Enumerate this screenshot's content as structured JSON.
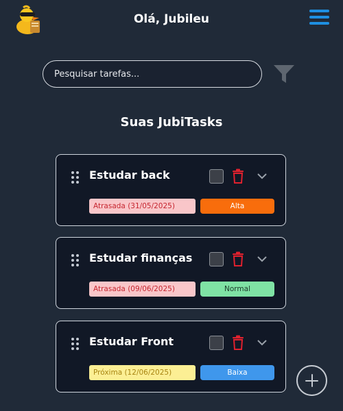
{
  "header": {
    "greeting": "Olá, Jubileu",
    "logo_icon": "duck-mascot-icon",
    "menu_icon": "hamburger-menu-icon"
  },
  "search": {
    "placeholder": "Pesquisar tarefas...",
    "value": "",
    "filter_icon": "filter-funnel-icon"
  },
  "section": {
    "title": "Suas JubiTasks"
  },
  "tasks": [
    {
      "title": "Estudar back",
      "due_label": "Atrasada (31/05/2025)",
      "due_status": "late",
      "priority": "Alta",
      "done": false
    },
    {
      "title": "Estudar finanças",
      "due_label": "Atrasada (09/06/2025)",
      "due_status": "late",
      "priority": "Normal",
      "done": false
    },
    {
      "title": "Estudar Front",
      "due_label": "Próxima (12/06/2025)",
      "due_status": "upcoming",
      "priority": "Baixa",
      "done": false
    }
  ],
  "colors": {
    "background": "#202a38",
    "card": "#111826",
    "accent_blue": "#1e8fe1",
    "delete_red": "#e0212e",
    "priority_alta": "#f86d0c",
    "priority_normal": "#7fe2a4",
    "priority_baixa": "#3f97ec"
  },
  "actions": {
    "add_icon": "plus-circle-icon"
  }
}
